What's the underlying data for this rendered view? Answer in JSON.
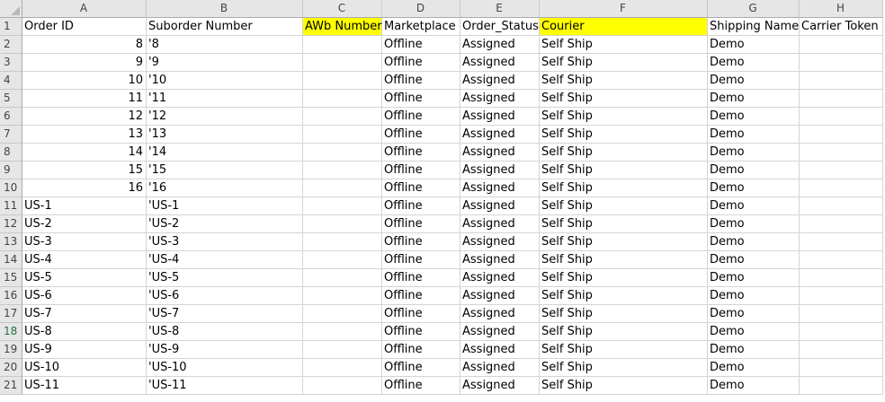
{
  "columns": [
    "A",
    "B",
    "C",
    "D",
    "E",
    "F",
    "G",
    "H"
  ],
  "highlight_color": "#ffff00",
  "header_row": {
    "row_number": "1",
    "cells": [
      "Order ID",
      "Suborder Number",
      "AWb Number",
      "Marketplace",
      "Order_Status",
      "Courier",
      "Shipping Name",
      "Carrier Token"
    ],
    "highlighted_columns": [
      "C",
      "F"
    ]
  },
  "rows": [
    {
      "row_number": "2",
      "order_id": "8",
      "suborder": "'8",
      "awb": "",
      "marketplace": "Offline",
      "status": "Assigned",
      "courier": "Self Ship",
      "shipping_name": "Demo",
      "carrier_token": ""
    },
    {
      "row_number": "3",
      "order_id": "9",
      "suborder": "'9",
      "awb": "",
      "marketplace": "Offline",
      "status": "Assigned",
      "courier": "Self Ship",
      "shipping_name": "Demo",
      "carrier_token": ""
    },
    {
      "row_number": "4",
      "order_id": "10",
      "suborder": "'10",
      "awb": "",
      "marketplace": "Offline",
      "status": "Assigned",
      "courier": "Self Ship",
      "shipping_name": "Demo",
      "carrier_token": ""
    },
    {
      "row_number": "5",
      "order_id": "11",
      "suborder": "'11",
      "awb": "",
      "marketplace": "Offline",
      "status": "Assigned",
      "courier": "Self Ship",
      "shipping_name": "Demo",
      "carrier_token": ""
    },
    {
      "row_number": "6",
      "order_id": "12",
      "suborder": "'12",
      "awb": "",
      "marketplace": "Offline",
      "status": "Assigned",
      "courier": "Self Ship",
      "shipping_name": "Demo",
      "carrier_token": ""
    },
    {
      "row_number": "7",
      "order_id": "13",
      "suborder": "'13",
      "awb": "",
      "marketplace": "Offline",
      "status": "Assigned",
      "courier": "Self Ship",
      "shipping_name": "Demo",
      "carrier_token": ""
    },
    {
      "row_number": "8",
      "order_id": "14",
      "suborder": "'14",
      "awb": "",
      "marketplace": "Offline",
      "status": "Assigned",
      "courier": "Self Ship",
      "shipping_name": "Demo",
      "carrier_token": ""
    },
    {
      "row_number": "9",
      "order_id": "15",
      "suborder": "'15",
      "awb": "",
      "marketplace": "Offline",
      "status": "Assigned",
      "courier": "Self Ship",
      "shipping_name": "Demo",
      "carrier_token": ""
    },
    {
      "row_number": "10",
      "order_id": "16",
      "suborder": "'16",
      "awb": "",
      "marketplace": "Offline",
      "status": "Assigned",
      "courier": "Self Ship",
      "shipping_name": "Demo",
      "carrier_token": ""
    },
    {
      "row_number": "11",
      "order_id": "US-1",
      "suborder": "'US-1",
      "awb": "",
      "marketplace": "Offline",
      "status": "Assigned",
      "courier": "Self Ship",
      "shipping_name": "Demo",
      "carrier_token": ""
    },
    {
      "row_number": "12",
      "order_id": "US-2",
      "suborder": "'US-2",
      "awb": "",
      "marketplace": "Offline",
      "status": "Assigned",
      "courier": "Self Ship",
      "shipping_name": "Demo",
      "carrier_token": ""
    },
    {
      "row_number": "13",
      "order_id": "US-3",
      "suborder": "'US-3",
      "awb": "",
      "marketplace": "Offline",
      "status": "Assigned",
      "courier": "Self Ship",
      "shipping_name": "Demo",
      "carrier_token": ""
    },
    {
      "row_number": "14",
      "order_id": "US-4",
      "suborder": "'US-4",
      "awb": "",
      "marketplace": "Offline",
      "status": "Assigned",
      "courier": "Self Ship",
      "shipping_name": "Demo",
      "carrier_token": ""
    },
    {
      "row_number": "15",
      "order_id": "US-5",
      "suborder": "'US-5",
      "awb": "",
      "marketplace": "Offline",
      "status": "Assigned",
      "courier": "Self Ship",
      "shipping_name": "Demo",
      "carrier_token": ""
    },
    {
      "row_number": "16",
      "order_id": "US-6",
      "suborder": "'US-6",
      "awb": "",
      "marketplace": "Offline",
      "status": "Assigned",
      "courier": "Self Ship",
      "shipping_name": "Demo",
      "carrier_token": ""
    },
    {
      "row_number": "17",
      "order_id": "US-7",
      "suborder": "'US-7",
      "awb": "",
      "marketplace": "Offline",
      "status": "Assigned",
      "courier": "Self Ship",
      "shipping_name": "Demo",
      "carrier_token": ""
    },
    {
      "row_number": "18",
      "order_id": "US-8",
      "suborder": "'US-8",
      "awb": "",
      "marketplace": "Offline",
      "status": "Assigned",
      "courier": "Self Ship",
      "shipping_name": "Demo",
      "carrier_token": ""
    },
    {
      "row_number": "19",
      "order_id": "US-9",
      "suborder": "'US-9",
      "awb": "",
      "marketplace": "Offline",
      "status": "Assigned",
      "courier": "Self Ship",
      "shipping_name": "Demo",
      "carrier_token": ""
    },
    {
      "row_number": "20",
      "order_id": "US-10",
      "suborder": "'US-10",
      "awb": "",
      "marketplace": "Offline",
      "status": "Assigned",
      "courier": "Self Ship",
      "shipping_name": "Demo",
      "carrier_token": ""
    },
    {
      "row_number": "21",
      "order_id": "US-11",
      "suborder": "'US-11",
      "awb": "",
      "marketplace": "Offline",
      "status": "Assigned",
      "courier": "Self Ship",
      "shipping_name": "Demo",
      "carrier_token": ""
    }
  ],
  "active_row": "18"
}
